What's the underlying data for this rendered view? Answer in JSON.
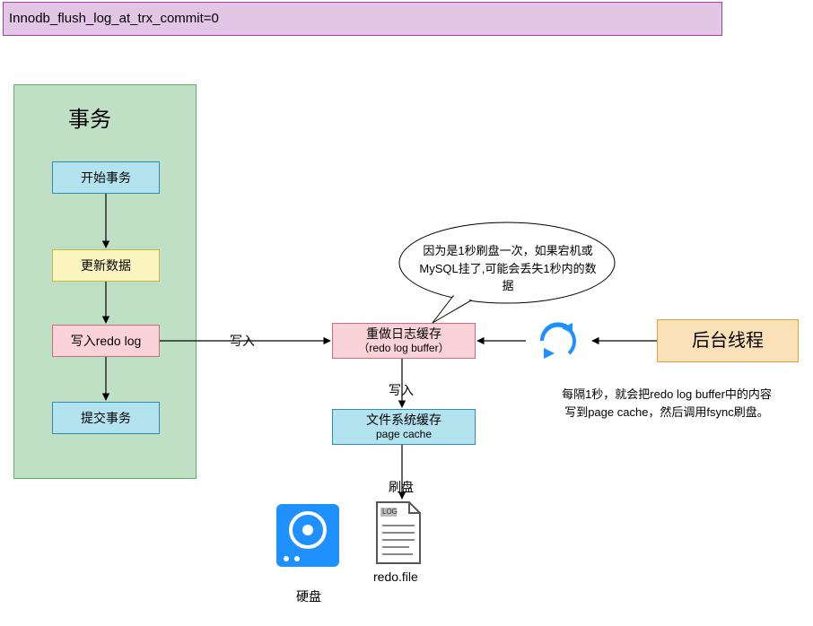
{
  "banner": {
    "text": "Innodb_flush_log_at_trx_commit=0"
  },
  "transaction": {
    "title": "事务",
    "steps": {
      "begin": "开始事务",
      "update": "更新数据",
      "redo": "写入redo log",
      "commit": "提交事务"
    }
  },
  "redo_buffer": {
    "line1": "重做日志缓存",
    "line2": "（redo log buffer）"
  },
  "page_cache": {
    "line1": "文件系统缓存",
    "line2": "page cache"
  },
  "bg_thread": {
    "label": "后台线程"
  },
  "labels": {
    "write1": "写入",
    "write2": "写入",
    "flush": "刷盘",
    "disk": "硬盘",
    "redofile": "redo.file",
    "logtag": "LOG"
  },
  "callout": {
    "text": "因为是1秒刷盘一次，如果宕机或MySQL挂了,可能会丢失1秒内的数据"
  },
  "note": {
    "line1": "每隔1秒，就会把redo log buffer中的内容",
    "line2": "写到page cache，然后调用fsync刷盘。"
  },
  "chart_data": {
    "type": "flow-diagram",
    "parameter": "Innodb_flush_log_at_trx_commit",
    "parameter_value": 0,
    "nodes": [
      {
        "id": "begin",
        "label": "开始事务",
        "group": "事务"
      },
      {
        "id": "update",
        "label": "更新数据",
        "group": "事务"
      },
      {
        "id": "redo",
        "label": "写入redo log",
        "group": "事务"
      },
      {
        "id": "commit",
        "label": "提交事务",
        "group": "事务"
      },
      {
        "id": "buf",
        "label": "重做日志缓存（redo log buffer）"
      },
      {
        "id": "pcache",
        "label": "文件系统缓存 page cache"
      },
      {
        "id": "disk",
        "label": "硬盘 / redo.file"
      },
      {
        "id": "bg",
        "label": "后台线程"
      }
    ],
    "edges": [
      {
        "from": "begin",
        "to": "update"
      },
      {
        "from": "update",
        "to": "redo"
      },
      {
        "from": "redo",
        "to": "commit"
      },
      {
        "from": "redo",
        "to": "buf",
        "label": "写入"
      },
      {
        "from": "buf",
        "to": "pcache",
        "label": "写入"
      },
      {
        "from": "pcache",
        "to": "disk",
        "label": "刷盘"
      },
      {
        "from": "bg",
        "to": "buf",
        "label": "每隔1秒",
        "loop": true
      }
    ],
    "annotation": "因为是1秒刷盘一次，如果宕机或MySQL挂了,可能会丢失1秒内的数据"
  }
}
